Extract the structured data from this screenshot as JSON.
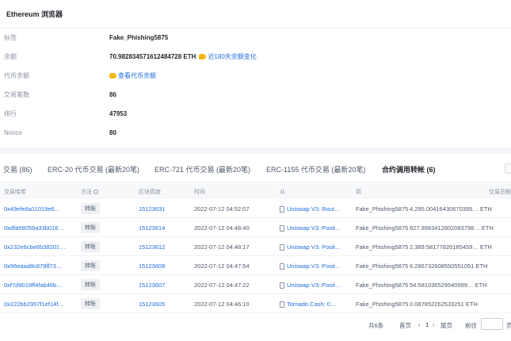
{
  "page_title": "Ethereum 浏览器",
  "info": {
    "label_tag": "标签",
    "tag_value": "Fake_Phishing5875",
    "label_balance": "余额",
    "balance_value": "70.982834571612484728 ETH",
    "balance_link": "近180天余额变化",
    "label_token_balance": "代币余额",
    "token_link": "查看代币余额",
    "label_tx_count": "交易笔数",
    "tx_count_value": "86",
    "label_rank": "排行",
    "rank_value": "47953",
    "label_nonce": "Nonce",
    "nonce_value": "80"
  },
  "tabs": [
    "交易 (86)",
    "ERC-20 代币交易 (最新20笔)",
    "ERC-721 代币交易 (最新20笔)",
    "ERC-1155 代币交易 (最新20笔)",
    "合约调用转帐 (6)"
  ],
  "table": {
    "headers": {
      "hash": "交易哈希",
      "method": "方法",
      "block": "区块高度",
      "time": "时间",
      "from": "从",
      "to": "到",
      "amount": "交易总额"
    },
    "rows": [
      {
        "hash": "0x49efe8a11019e6…",
        "method": "转账",
        "block": "15123631",
        "time": "2022-07-12 04:52:07",
        "from": "Uniswap V3: Rout…",
        "to": "Fake_Phishing5875",
        "amount": "4,295.00416430670395… ETH"
      },
      {
        "hash": "0xdfa59059a33b016…",
        "method": "转账",
        "block": "15123614",
        "time": "2022-07-12 04:48:40",
        "from": "Uniswap V3: Posit…",
        "to": "Fake_Phishing5875",
        "amount": "827.9983412802083798… ETH"
      },
      {
        "hash": "0x232e6cbe6b38201…",
        "method": "转账",
        "block": "15123612",
        "time": "2022-07-12 04:48:17",
        "from": "Uniswap V3: Posit…",
        "to": "Fake_Phishing5875",
        "amount": "2,389.58177826185459… ETH"
      },
      {
        "hash": "0x96eaad8c878ff73…",
        "method": "转账",
        "block": "15123608",
        "time": "2022-07-12 04:47:54",
        "from": "Uniswap V3: Posit…",
        "to": "Fake_Phishing5875",
        "amount": "6.286732608550551051 ETH"
      },
      {
        "hash": "0xf7d9019ff4fab46b…",
        "method": "转账",
        "block": "15123607",
        "time": "2022-07-12 04:47:22",
        "from": "Uniswap V3: Posit…",
        "to": "Fake_Phishing5875",
        "amount": "54.581036529540999… ETH"
      },
      {
        "hash": "0x222bb2957f1ef14f…",
        "method": "转账",
        "block": "15123605",
        "time": "2022-07-12 04:46:10",
        "from": "Tornado Cash: 0…",
        "to": "Fake_Phishing5875",
        "amount": "0.087852262533251 ETH"
      }
    ]
  },
  "pager": {
    "total": "共6条",
    "first": "首页",
    "prev": "‹",
    "current": "1",
    "next": "›",
    "last": "尾页",
    "goto": "前往",
    "page_unit": "页"
  },
  "colors": {
    "link": "#1e6fe0",
    "accent_icon": "#f5b81c"
  }
}
